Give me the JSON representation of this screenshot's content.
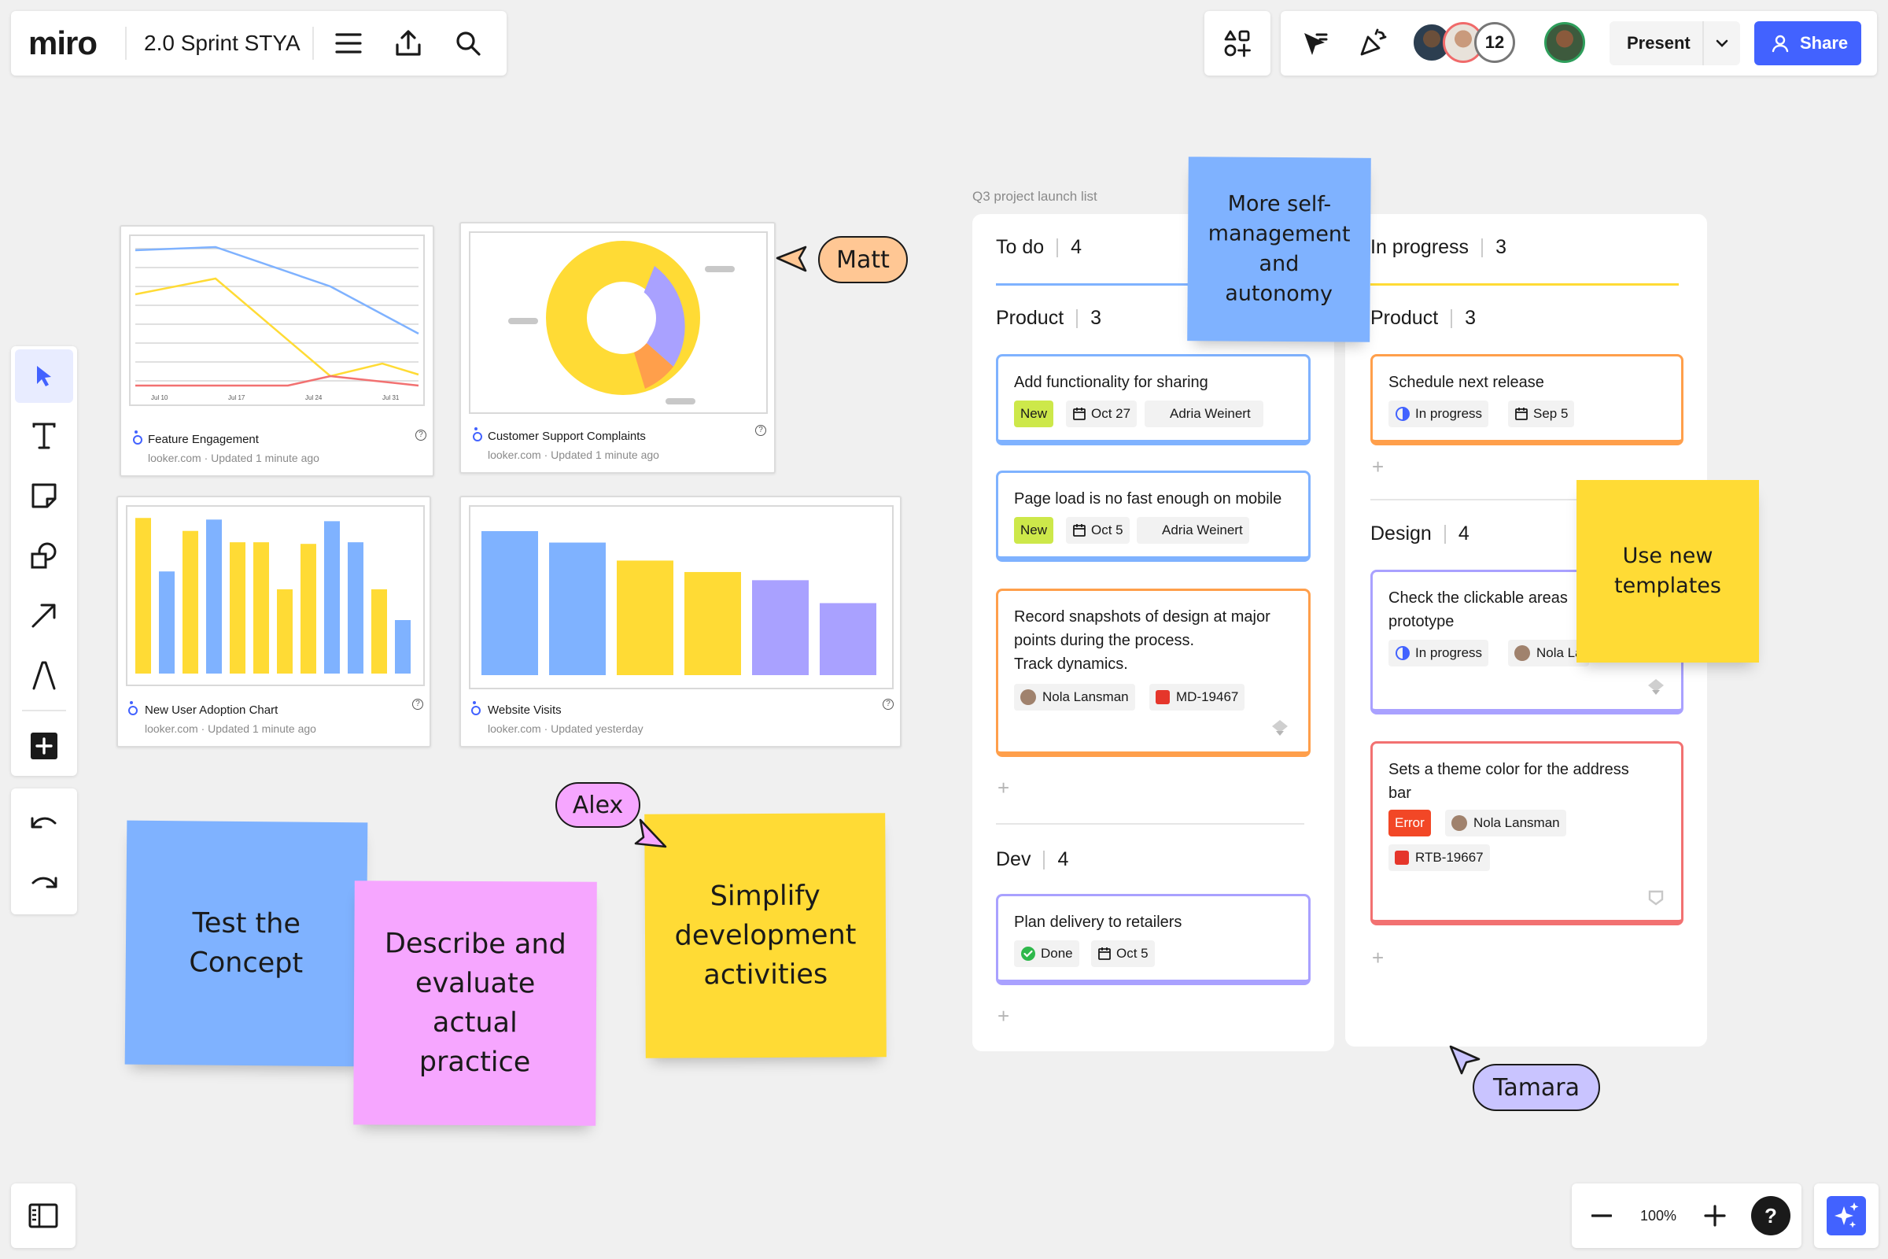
{
  "app": {
    "logo": "miro",
    "board_title": "2.0 Sprint STYA"
  },
  "collab": {
    "avatar_overflow_count": "12",
    "present_label": "Present",
    "share_label": "Share"
  },
  "zoom": {
    "level": "100%",
    "help": "?"
  },
  "looker_cards": [
    {
      "title": "Feature Engagement",
      "source": "looker.com",
      "updated": "Updated 1 minute ago"
    },
    {
      "title": "Customer Support Complaints",
      "source": "looker.com",
      "updated": "Updated 1 minute ago"
    },
    {
      "title": "New User Adoption Chart",
      "source": "looker.com",
      "updated": "Updated 1 minute ago"
    },
    {
      "title": "Website Visits",
      "source": "looker.com",
      "updated": "Updated yesterday"
    }
  ],
  "line_chart_ticks": [
    "Jul 10",
    "Jul 17",
    "Jul 24",
    "Jul 31"
  ],
  "kanban": {
    "board_label": "Q3 project launch list",
    "columns": [
      {
        "title": "To do",
        "count": "4",
        "groups": [
          {
            "title": "Product",
            "count": "3"
          },
          {
            "title": "Dev",
            "count": "4"
          }
        ]
      },
      {
        "title": "In progress",
        "count": "3",
        "groups": [
          {
            "title": "Product",
            "count": "3"
          },
          {
            "title": "Design",
            "count": "4"
          }
        ]
      }
    ],
    "cards": [
      {
        "title": "Add functionality for sharing",
        "status": "New",
        "date": "Oct 27",
        "assignee": "Adria Weinert"
      },
      {
        "title": "Page load is no fast enough on mobile",
        "status": "New",
        "date": "Oct 5",
        "assignee": "Adria Weinert"
      },
      {
        "title_lines": [
          "Record snapshots of design at major",
          "points during the process.",
          "Track dynamics."
        ],
        "assignee": "Nola Lansman",
        "ticket": "MD-19467"
      },
      {
        "title": "Plan delivery to retailers",
        "status": "Done",
        "date": "Oct 5"
      },
      {
        "title": "Schedule next release",
        "status": "In progress",
        "date": "Sep 5"
      },
      {
        "title_lines": [
          "Check the clickable areas",
          "prototype"
        ],
        "status": "In progress",
        "assignee": "Nola La"
      },
      {
        "title_lines": [
          "Sets a theme color for the address",
          "bar"
        ],
        "status": "Error",
        "assignee": "Nola Lansman",
        "ticket": "RTB-19667"
      }
    ]
  },
  "stickies": {
    "self_management": [
      "More self-",
      "management",
      "and",
      "autonomy"
    ],
    "templates": [
      "Use new",
      "templates"
    ],
    "test_concept": [
      "Test the",
      "Concept"
    ],
    "describe": [
      "Describe and",
      "evaluate",
      "actual",
      "practice"
    ],
    "simplify": [
      "Simplify",
      "development",
      "activities"
    ]
  },
  "cursors": {
    "matt": "Matt",
    "alex": "Alex",
    "tamara": "Tamara"
  },
  "colors": {
    "accent": "#4262ff",
    "sticky_blue": "#7fb2ff",
    "sticky_yellow": "#ffdb35",
    "sticky_pink": "#f6a6ff",
    "chart_blue": "#7fb2ff",
    "chart_yellow": "#ffdb35",
    "chart_purple": "#a9a1ff",
    "chart_orange": "#ff9f4b"
  }
}
